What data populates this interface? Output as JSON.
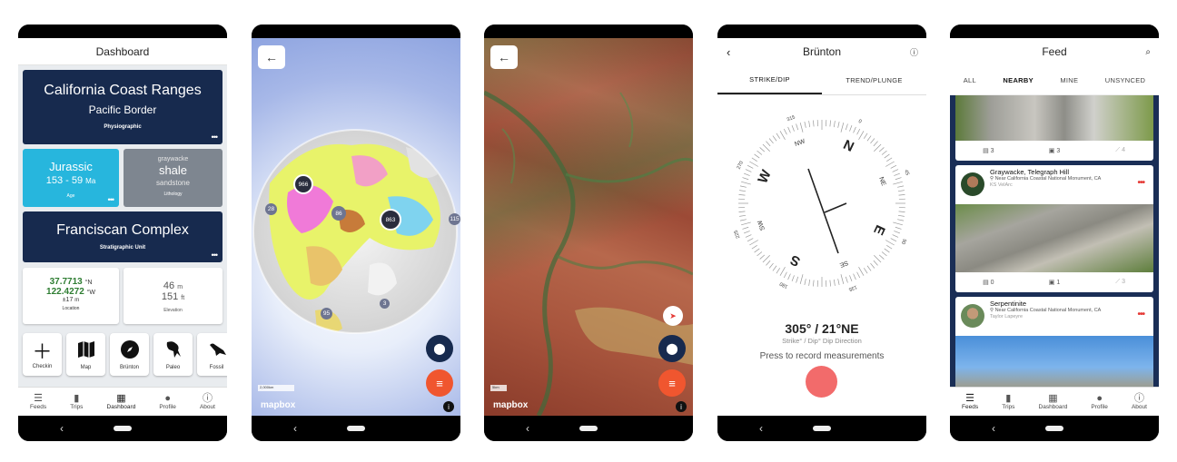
{
  "dashboard": {
    "title": "Dashboard",
    "province": {
      "name": "California Coast Ranges",
      "division": "Pacific Border",
      "label": "Physiographic",
      "more": "•••"
    },
    "age": {
      "name": "Jurassic",
      "range": "153 - 59",
      "unit": "Ma",
      "label": "Age",
      "more": "•••"
    },
    "lithology": {
      "top": "graywacke",
      "main": "shale",
      "bottom": "sandstone",
      "label": "Lithology"
    },
    "unit": {
      "name": "Franciscan Complex",
      "label": "Stratigraphic Unit",
      "more": "•••"
    },
    "location": {
      "lat": "37.7713",
      "lat_dir": "°N",
      "lon": "122.4272",
      "lon_dir": "°W",
      "accuracy": "±17",
      "acc_unit": "m",
      "label": "Location"
    },
    "elevation": {
      "m": "46",
      "m_unit": "m",
      "ft": "151",
      "ft_unit": "ft",
      "label": "Elevation"
    },
    "tools": [
      {
        "label": "Checkin",
        "icon": "plus-icon"
      },
      {
        "label": "Map",
        "icon": "map-icon"
      },
      {
        "label": "Brünton",
        "icon": "compass-icon"
      },
      {
        "label": "Paleo",
        "icon": "dinosaur-icon"
      },
      {
        "label": "Fossil",
        "icon": "bird-icon"
      }
    ]
  },
  "nav": {
    "feeds": "Feeds",
    "trips": "Trips",
    "dashboard": "Dashboard",
    "profile": "Profile",
    "about": "About"
  },
  "globe": {
    "clusters": [
      "966",
      "86",
      "863",
      "28",
      "115",
      "3",
      "95"
    ],
    "scale": "2,000km",
    "mapbox": "mapbox"
  },
  "terrain": {
    "scale": "5km",
    "mapbox": "mapbox"
  },
  "brunton": {
    "title": "Brünton",
    "tabs": [
      "STRIKE/DIP",
      "TREND/PLUNGE"
    ],
    "reading": "305° / 21°NE",
    "reading_label": "Strike° / Dip° Dip Direction",
    "prompt": "Press to record measurements",
    "compass_labels": {
      "n": "N",
      "ne": "NE",
      "e": "E",
      "se": "SE",
      "s": "S",
      "sw": "SW",
      "w": "W",
      "nw": "NW"
    },
    "compass_numbers": [
      "0",
      "45",
      "90",
      "135",
      "180",
      "225",
      "270",
      "315"
    ]
  },
  "feed": {
    "title": "Feed",
    "tabs": [
      "ALL",
      "NEARBY",
      "MINE",
      "UNSYNCED"
    ],
    "top_stats": [
      "3",
      "3",
      "4"
    ],
    "posts": [
      {
        "title": "Graywacke, Telegraph Hill",
        "location": "Near California Coastal National Monument, CA",
        "user": "KS VelArc",
        "stats": [
          "0",
          "1",
          "3"
        ]
      },
      {
        "title": "Serpentinite",
        "location": "Near California Coastal National Monument, CA",
        "user": "Taylor Lapeyre"
      }
    ]
  },
  "colors": {
    "navy": "#172a4e",
    "cyan": "#27b6dd",
    "gray": "#7e8690",
    "red": "#e53935",
    "record": "#f26b6b"
  }
}
